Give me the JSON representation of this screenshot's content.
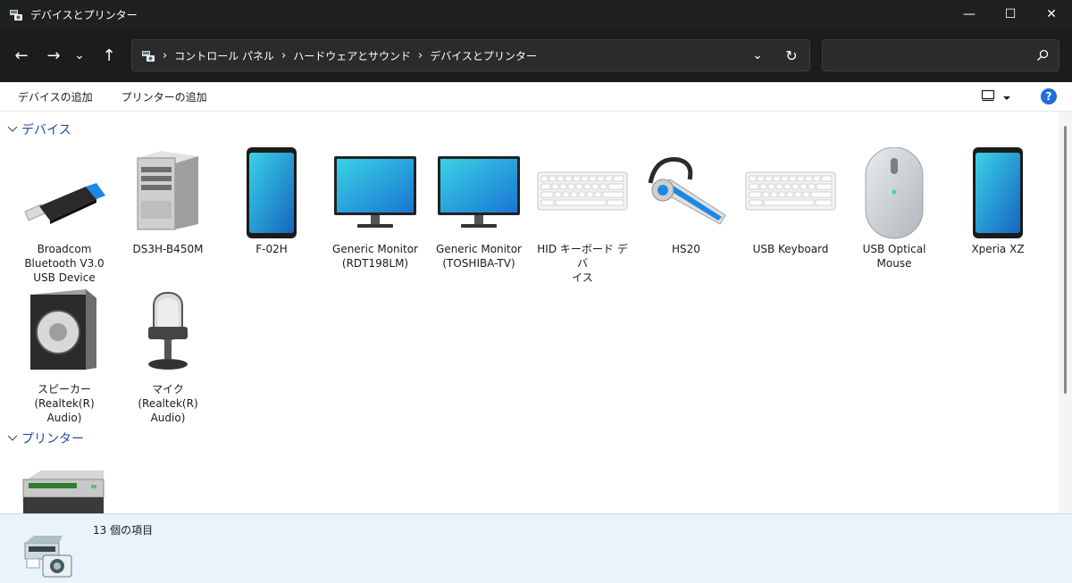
{
  "window": {
    "title": "デバイスとプリンター"
  },
  "titlebar_buttons": {
    "minimize": "—",
    "maximize": "☐",
    "close": "✕"
  },
  "nav": {
    "back": "←",
    "forward": "→",
    "recent": "⌄",
    "up": "↑",
    "breadcrumb": [
      "コントロール パネル",
      "ハードウェアとサウンド",
      "デバイスとプリンター"
    ],
    "separator": "›",
    "dropdown": "⌄",
    "refresh": "↻"
  },
  "search": {
    "value": "",
    "placeholder": ""
  },
  "commands": {
    "add_device": "デバイスの追加",
    "add_printer": "プリンターの追加",
    "help": "?"
  },
  "groups": {
    "devices": {
      "title": "デバイス",
      "items": [
        {
          "label": "Broadcom\nBluetooth V3.0\nUSB Device",
          "icon": "usb-dongle-icon"
        },
        {
          "label": "DS3H-B450M",
          "icon": "pc-tower-icon"
        },
        {
          "label": "F-02H",
          "icon": "smartphone-icon"
        },
        {
          "label": "Generic Monitor\n(RDT198LM)",
          "icon": "monitor-icon"
        },
        {
          "label": "Generic Monitor\n(TOSHIBA-TV)",
          "icon": "monitor-icon"
        },
        {
          "label": "HID キーボード デバ\nイス",
          "icon": "keyboard-icon"
        },
        {
          "label": "HS20",
          "icon": "headset-icon"
        },
        {
          "label": "USB Keyboard",
          "icon": "keyboard-icon"
        },
        {
          "label": "USB Optical\nMouse",
          "icon": "mouse-icon"
        },
        {
          "label": "Xperia XZ",
          "icon": "smartphone-icon"
        },
        {
          "label": "スピーカー\n(Realtek(R)\nAudio)",
          "icon": "speaker-icon"
        },
        {
          "label": "マイク (Realtek(R)\nAudio)",
          "icon": "microphone-icon"
        }
      ]
    },
    "printers": {
      "title": "プリンター",
      "items": [
        {
          "label": "",
          "icon": "printer-icon"
        }
      ]
    }
  },
  "status": {
    "item_count": "13 個の項目"
  },
  "colors": {
    "titlebar": "#202020",
    "navbar": "#1c1c1c",
    "accent": "#1e4e9a",
    "details_bg": "#eaf2fb"
  }
}
